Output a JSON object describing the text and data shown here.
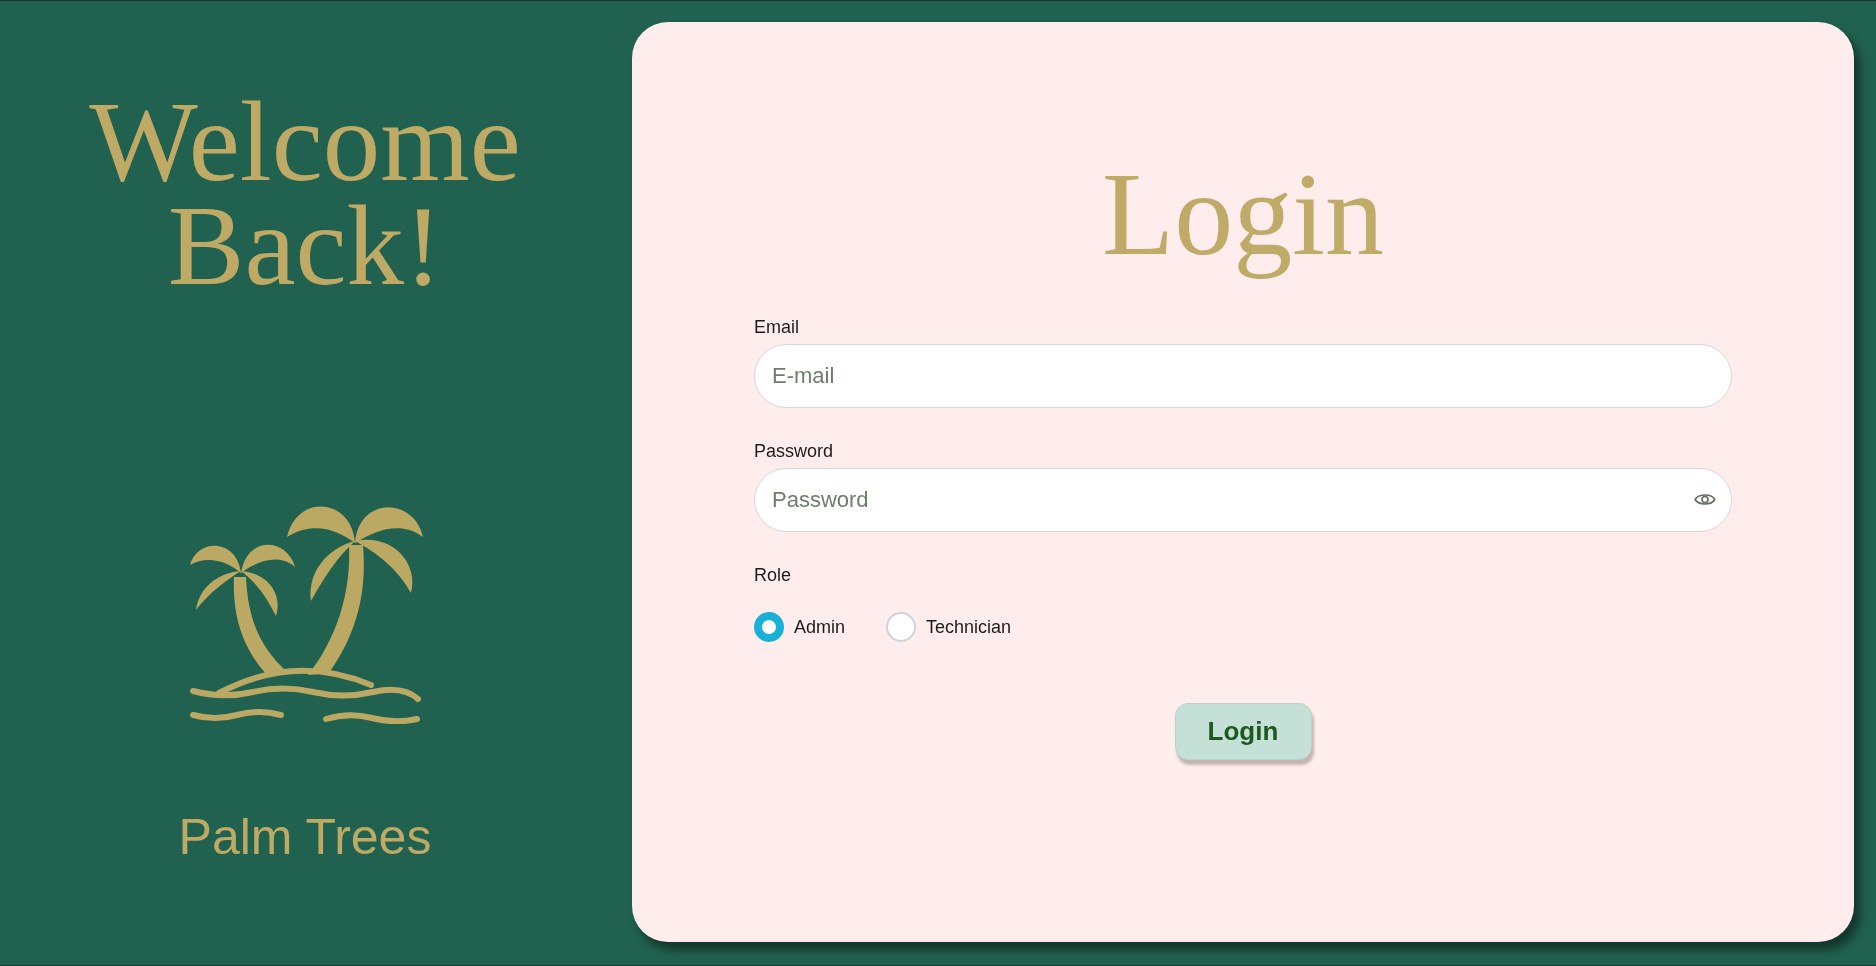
{
  "welcome": {
    "title": "Welcome Back!"
  },
  "brand": {
    "name": "Palm Trees"
  },
  "login_form": {
    "title": "Login",
    "fields": [
      {
        "label": "Email",
        "placeholder": "E-mail",
        "kind": "text"
      },
      {
        "label": "Password",
        "placeholder": "Password",
        "kind": "password"
      }
    ],
    "role": {
      "label": "Role",
      "options": [
        {
          "label": "Admin",
          "selected": true
        },
        {
          "label": "Technician",
          "selected": false
        }
      ]
    },
    "submit": "Login"
  }
}
